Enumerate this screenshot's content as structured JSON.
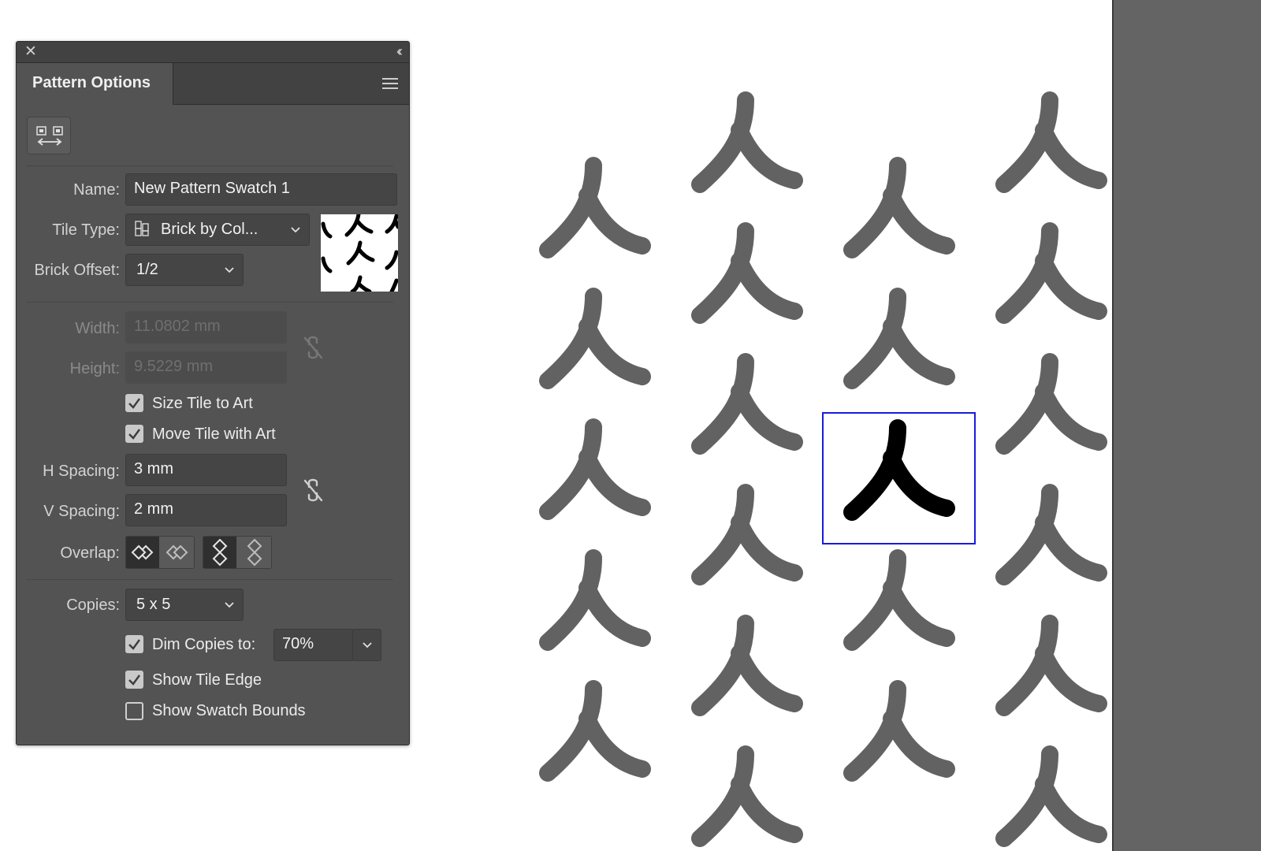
{
  "panel": {
    "title": "Pattern Options",
    "name_label": "Name:",
    "name_value": "New Pattern Swatch 1",
    "tile_type_label": "Tile Type:",
    "tile_type_value": "Brick by Col...",
    "brick_offset_label": "Brick Offset:",
    "brick_offset_value": "1/2",
    "width_label": "Width:",
    "width_value": "11.0802 mm",
    "height_label": "Height:",
    "height_value": "9.5229 mm",
    "size_tile_to_art_label": "Size Tile to Art",
    "size_tile_to_art_checked": true,
    "move_tile_with_art_label": "Move Tile with Art",
    "move_tile_with_art_checked": true,
    "h_spacing_label": "H Spacing:",
    "h_spacing_value": "3 mm",
    "v_spacing_label": "V Spacing:",
    "v_spacing_value": "2 mm",
    "overlap_label": "Overlap:",
    "copies_label": "Copies:",
    "copies_value": "5 x 5",
    "dim_copies_label": "Dim Copies to:",
    "dim_copies_checked": true,
    "dim_copies_value": "70%",
    "show_tile_edge_label": "Show Tile Edge",
    "show_tile_edge_checked": true,
    "show_swatch_bounds_label": "Show Swatch Bounds",
    "show_swatch_bounds_checked": false
  },
  "icons": {
    "close": "close-icon",
    "collapse": "double-chevron-left-icon",
    "menu": "hamburger-menu-icon",
    "edit_tile": "pattern-tile-tool-icon",
    "tile_type": "brick-tile-icon",
    "link": "unlinked-chain-icon"
  },
  "colors": {
    "panel_bg": "#535353",
    "copy_glyph": "#626262",
    "tile_glyph": "#000000",
    "tile_edge": "#1a1adf"
  }
}
